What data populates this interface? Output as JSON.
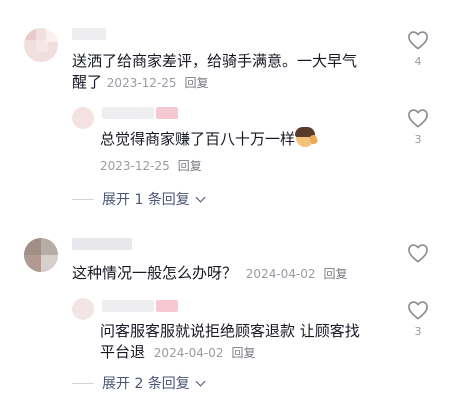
{
  "comments": [
    {
      "text_line1": "送洒了给商家差评，给骑手满意。一大早气",
      "text_line2": "醒了",
      "date": "2023-12-25",
      "reply_label": "回复",
      "likes": "4",
      "replies": [
        {
          "text": "总觉得商家赚了百八十万一样",
          "emoji_icon": "person-shrugging-icon",
          "date": "2023-12-25",
          "reply_label": "回复",
          "likes": "3"
        }
      ],
      "expand_label": "展开 1 条回复"
    },
    {
      "text": "这种情况一般怎么办呀？",
      "date": "2024-04-02",
      "reply_label": "回复",
      "likes": "",
      "replies": [
        {
          "text_line1": "问客服客服就说拒绝顾客退款 让顾客找",
          "text_line2": "平台退",
          "date": "2024-04-02",
          "reply_label": "回复",
          "likes": "3"
        }
      ],
      "expand_label": "展开 2 条回复"
    }
  ],
  "colors": {
    "text": "#161823",
    "meta": "#9b9ba3",
    "link": "#4a5577",
    "heart_stroke": "#8a8a92",
    "name_blur_pink": "#f6c9d2"
  },
  "icons": {
    "like": "heart-outline-icon",
    "expand": "chevron-down-icon"
  }
}
